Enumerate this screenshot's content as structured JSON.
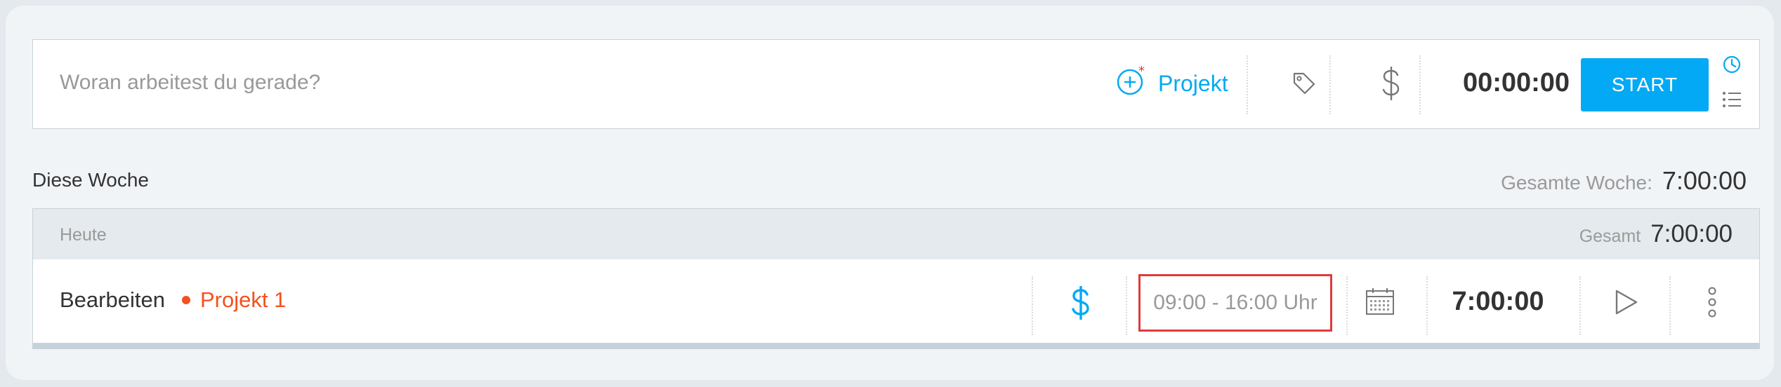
{
  "tracker": {
    "description_placeholder": "Woran arbeitest du gerade?",
    "project_label": "Projekt",
    "timer": "00:00:00",
    "start_label": "START",
    "icons": [
      "plus-circle-icon",
      "tag-icon",
      "dollar-icon",
      "clock-icon",
      "list-icon"
    ],
    "accent_color": "#03a9f4"
  },
  "week": {
    "label": "Diese Woche",
    "total_label": "Gesamte Woche:",
    "total_value": "7:00:00"
  },
  "group": {
    "label": "Heute",
    "total_label": "Gesamt",
    "total_value": "7:00:00",
    "entries": [
      {
        "description": "Bearbeiten",
        "project": "Projekt 1",
        "project_color": "#f4511e",
        "billable": true,
        "time_range": "09:00 - 16:00 Uhr",
        "duration": "7:00:00",
        "icons": [
          "dollar-icon",
          "calendar-icon",
          "play-icon",
          "more-vertical-icon"
        ]
      }
    ]
  }
}
